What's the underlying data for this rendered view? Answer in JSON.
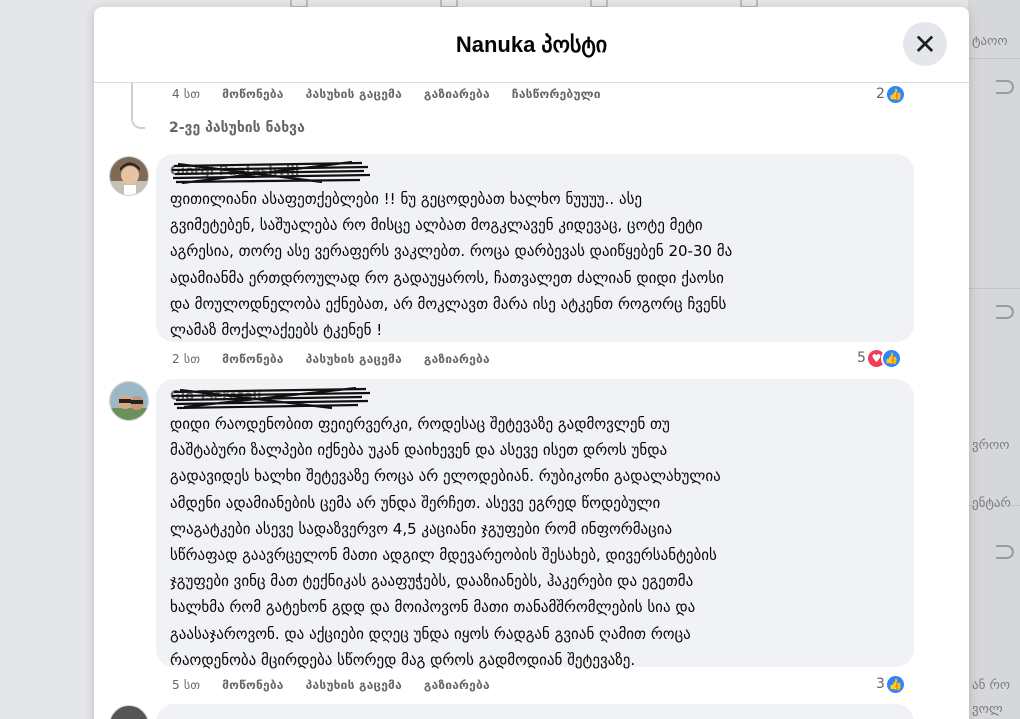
{
  "modal": {
    "title": "Nanuka პოსტი",
    "close_label": "✕"
  },
  "background": {
    "fragments": [
      "ტაოო",
      "ვროო",
      "ენტარ",
      "ან რო",
      "ვოლ"
    ]
  },
  "top_reply": {
    "time": "4 სთ",
    "like": "მოწონება",
    "reply": "პასუხის გაცემა",
    "share": "გაზიარება",
    "edited": "ჩასწორებული",
    "reaction_count": "2"
  },
  "view_replies": "2-ვე პასუხის ნახვა",
  "comments": [
    {
      "author": "Giorgi Paatashvili",
      "text": "ფითილიანი ასაფეთქებლები !! ნუ გეცოდებათ ხალხო ნუუუუ.. ასე\nგვიმეტებენ, საშუალება რო მისცე ალბათ მოგკლავენ კიდევაც, ცოტე მეტი\nაგრესია, თორე ასე ვერაფერს ვაკლებთ. როცა დარბევას დაიწყებენ 20-30 მა\nადამიანმა ერთდროულად რო გადაუყაროს, ჩათვალეთ ძალიან დიდი ქაოსი\nდა მოულოდნელობა ექნებათ, არ მოკლავთ მარა ისე ატკენთ როგორც ჩვენს\nლამაზ მოქალაქეებს ტკენენ !",
      "time": "2 სთ",
      "like": "მოწონება",
      "reply": "პასუხის გაცემა",
      "share": "გაზიარება",
      "reaction_count": "5"
    },
    {
      "author": "Gio Tsereteli",
      "text": "დიდი რაოდენობით ფეიერვერკი, როდესაც შეტევაზე გადმოვლენ თუ\nმაშტაბური ზალპები იქნება უკან დაიხევენ და ასევე ისეთ დროს უნდა\nგადავიდეს ხალხი შეტევაზე როცა არ ელოდებიან. რუბიკონი გადალახულია\nამდენი ადამიანების ცემა არ უნდა შერჩეთ. ასევე ეგრედ წოდებული\nლაგატკები ასევე სადაზვერვო 4,5 კაციანი ჯგუფები რომ ინფორმაცია\nსწრაფად გაავრცელონ მათი ადგილ მდევარეობის შესახებ, დივერსანტების\nჯგუფები ვინც მათ ტექნიკას გააფუჭებს, დააზიანებს, ჰაკერები და ეგეთმა\nხალხმა რომ გატეხონ გდდ და მოიპოვონ მათი თანამშრომლების სია და\nგაასაჯაროვონ. და აქციები დღეც უნდა იყოს რადგან გვიან ღამით როცა\nრაოდენობა მცირდება სწორედ მაგ დროს გადმოდიან შეტევაზე.",
      "time": "5 სთ",
      "like": "მოწონება",
      "reply": "პასუხის გაცემა",
      "share": "გაზიარება",
      "reaction_count": "3"
    }
  ],
  "colors": {
    "like_blue": "#2d86ff",
    "love_red": "#f33e58",
    "bubble_bg": "#f0f2f5",
    "meta_gray": "#65676b"
  }
}
